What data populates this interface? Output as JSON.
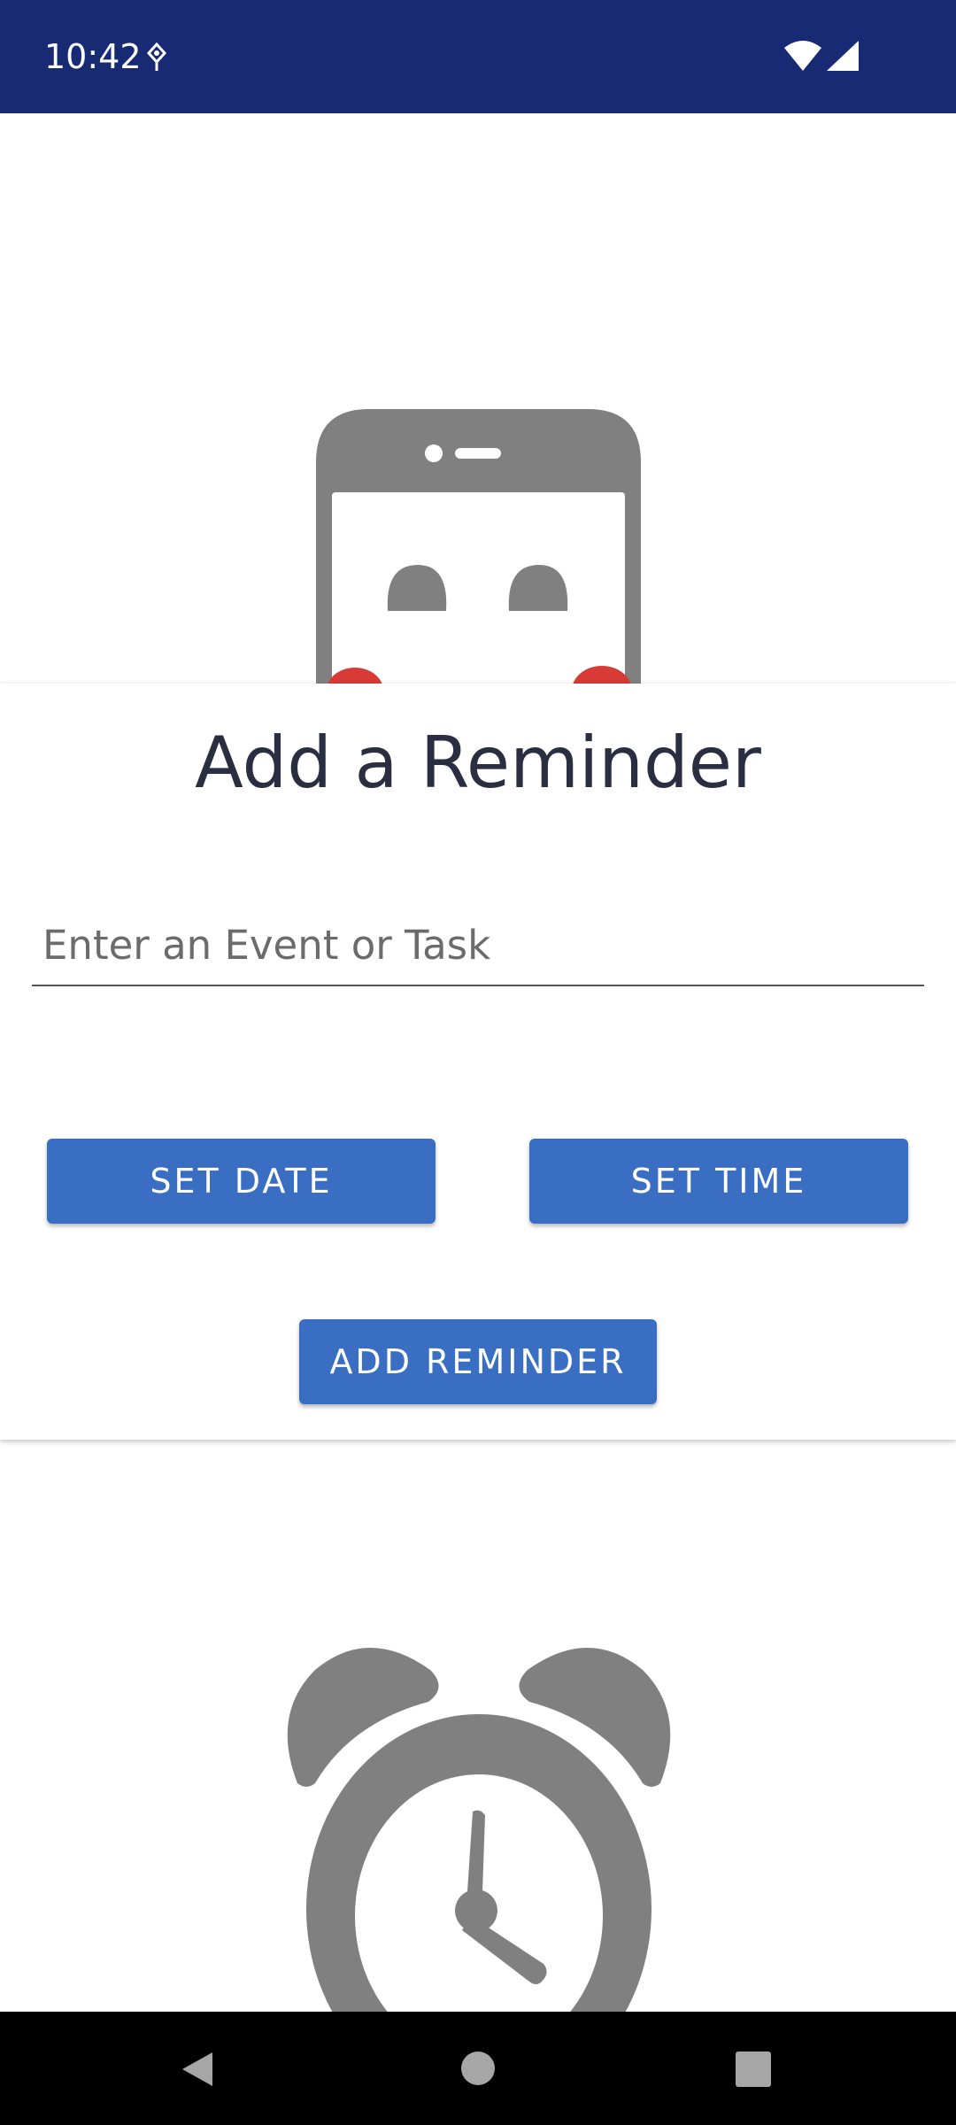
{
  "status_bar": {
    "time": "10:42",
    "icons": [
      "notification-icon",
      "wifi-icon",
      "signal-icon"
    ]
  },
  "illustrations": {
    "top": "phone-illustration",
    "bottom": "alarm-clock-illustration"
  },
  "card": {
    "title": "Add a Reminder",
    "input": {
      "value": "",
      "placeholder": "Enter an Event or Task"
    },
    "buttons": {
      "set_date": "SET DATE",
      "set_time": "SET TIME",
      "add_reminder": "ADD REMINDER"
    }
  },
  "nav_bar": {
    "icons": [
      "back-icon",
      "home-icon",
      "recents-icon"
    ]
  },
  "colors": {
    "status_bar": "#182a74",
    "button": "#3a6ec2",
    "title_text": "#2a2e40",
    "illustration_gray": "#808080",
    "illustration_red": "#d83b36"
  }
}
